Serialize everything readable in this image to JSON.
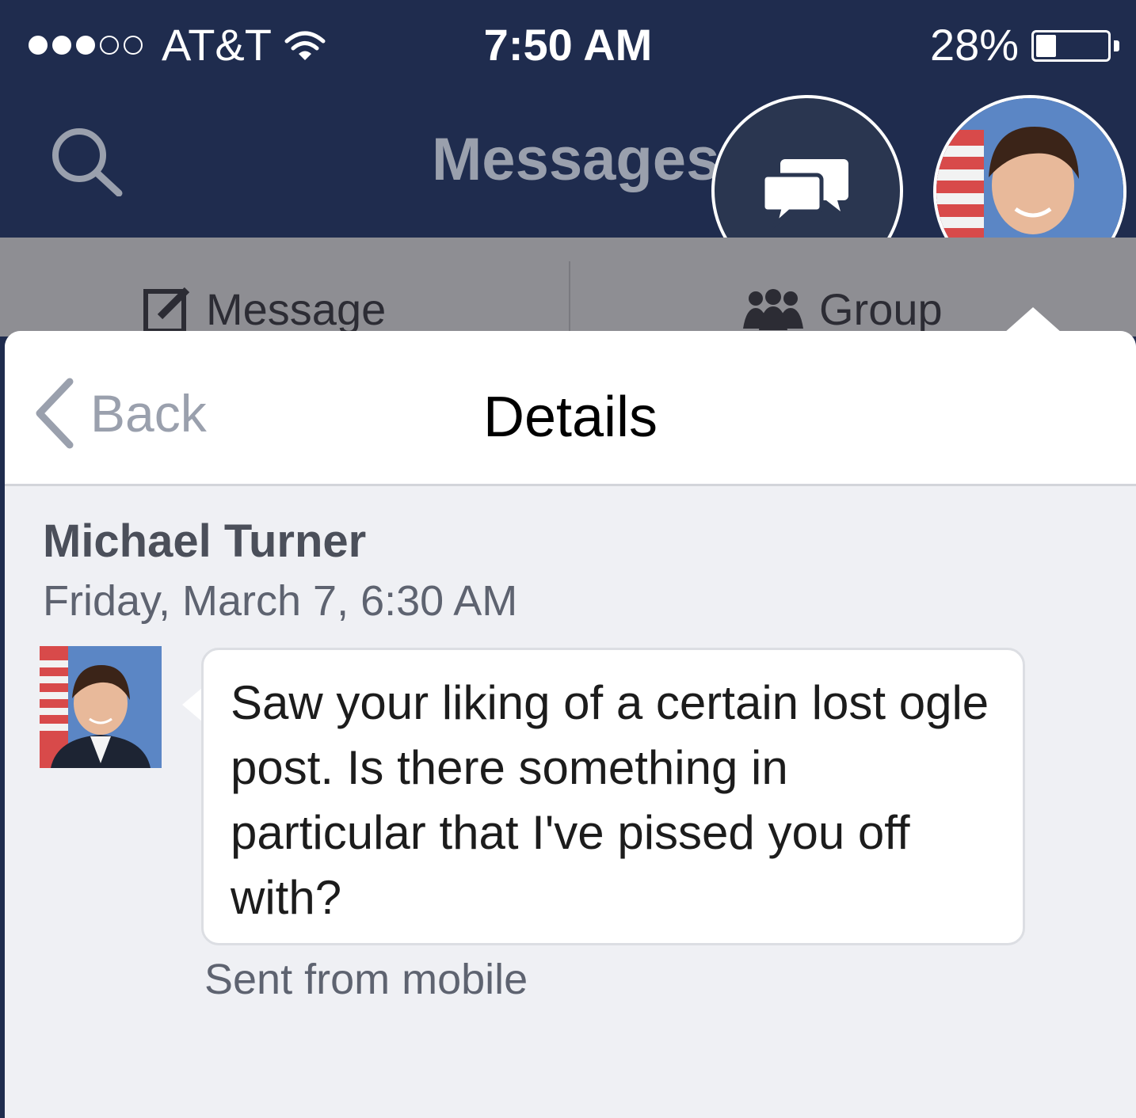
{
  "status_bar": {
    "carrier": "AT&T",
    "time": "7:50 AM",
    "battery_percent": "28%",
    "battery_level": 0.28,
    "signal_bars_filled": 3,
    "signal_bars_total": 5
  },
  "nav": {
    "title": "Messages",
    "search_icon": "search-icon",
    "chat_icon": "chat-bubbles-icon"
  },
  "compose": {
    "message_label": "Message",
    "group_label": "Group"
  },
  "details": {
    "back_label": "Back",
    "title": "Details"
  },
  "message": {
    "sender": "Michael Turner",
    "timestamp": "Friday, March 7, 6:30 AM",
    "body": "Saw your liking of a certain lost ogle post. Is there something in particular that I've pissed you off with?",
    "sent_via": "Sent from mobile"
  },
  "colors": {
    "nav_background": "#1f2c4e",
    "compose_background": "#8e8e93",
    "popover_background": "#eff0f4"
  }
}
